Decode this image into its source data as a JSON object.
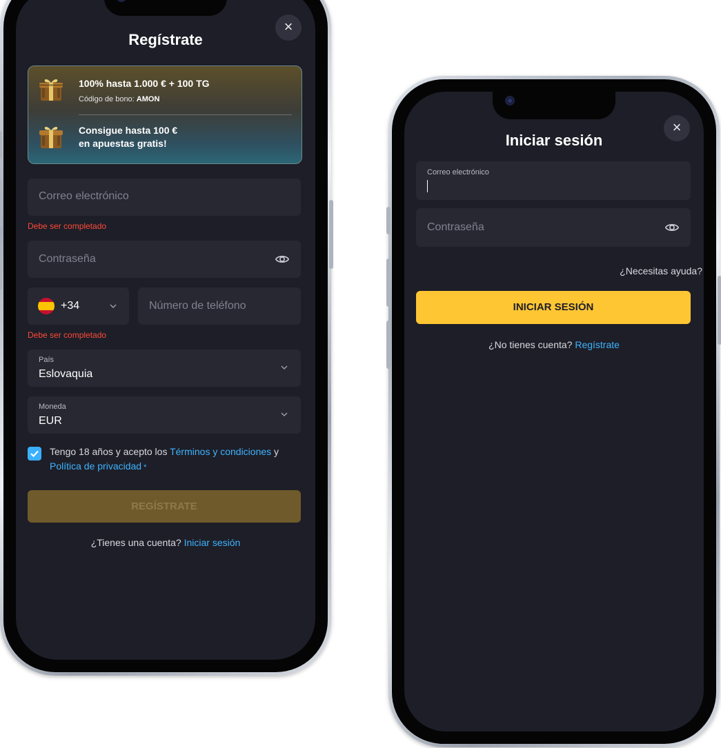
{
  "register": {
    "title": "Regístrate",
    "close_icon": "close-icon",
    "promo": {
      "line1": "100% hasta 1.000 € + 100 TG",
      "code_label": "Código de bono: ",
      "code_value": "AMON",
      "line2a": "Consigue hasta 100 €",
      "line2b": "en apuestas gratis!"
    },
    "email_placeholder": "Correo electrónico",
    "email_error": "Debe ser completado",
    "password_placeholder": "Contraseña",
    "phone_code": "+34",
    "phone_placeholder": "Número de teléfono",
    "phone_error": "Debe ser completado",
    "country_label": "País",
    "country_value": "Eslovaquia",
    "currency_label": "Moneda",
    "currency_value": "EUR",
    "terms_prefix": "Tengo 18 años y acepto los ",
    "terms_link": "Términos y condiciones",
    "terms_and": " y",
    "privacy_link": "Política de privacidad",
    "required_mark": " *",
    "submit_label": "REGÍSTRATE",
    "have_account": "¿Tienes una cuenta? ",
    "login_link": "Iniciar sesión"
  },
  "login": {
    "title": "Iniciar sesión",
    "close_icon": "close-icon",
    "email_label": "Correo electrónico",
    "email_value": "",
    "password_placeholder": "Contraseña",
    "help_link": "¿Necesitas ayuda?",
    "submit_label": "INICIAR SESIÓN",
    "no_account": "¿No tienes cuenta? ",
    "register_link": "Regístrate"
  },
  "colors": {
    "screen_bg": "#1d1e27",
    "field_bg": "#272832",
    "accent_yellow": "#ffc634",
    "accent_yellow_disabled": "#6f5a2b",
    "link_blue": "#3fb3ff",
    "error_red": "#ff4a3a"
  }
}
